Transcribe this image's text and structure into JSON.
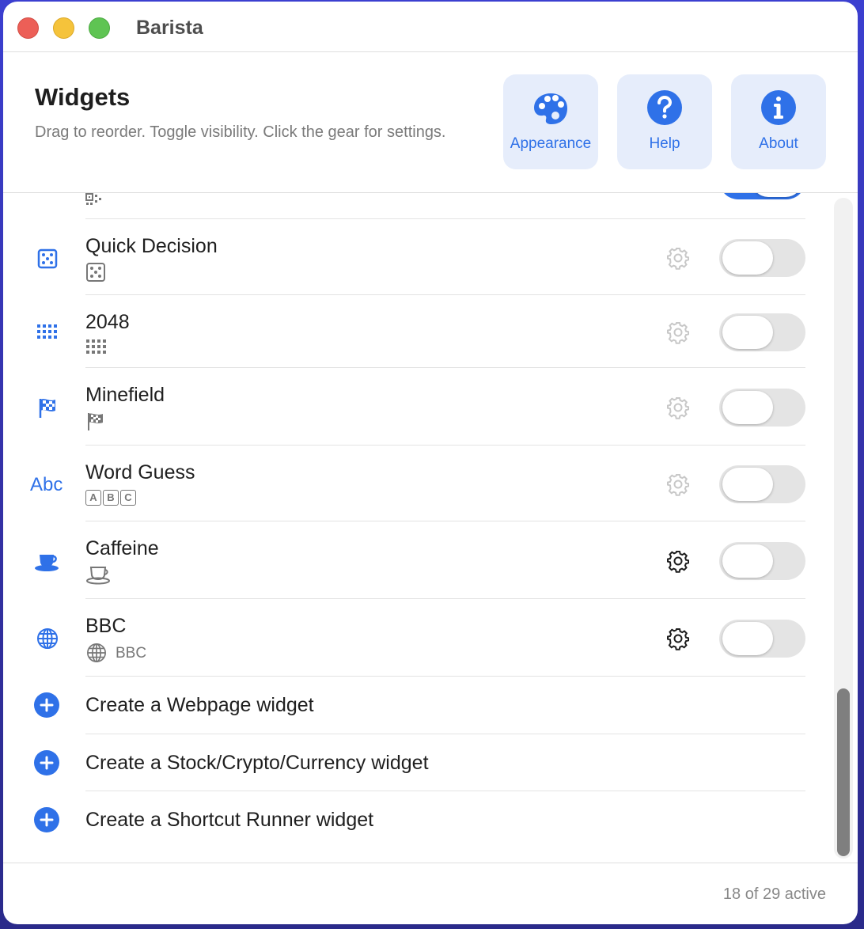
{
  "window": {
    "title": "Barista"
  },
  "header": {
    "title": "Widgets",
    "subtitle": "Drag to reorder. Toggle visibility. Click the gear for settings.",
    "buttons": [
      {
        "label": "Appearance",
        "icon": "palette-icon"
      },
      {
        "label": "Help",
        "icon": "question-circle-icon"
      },
      {
        "label": "About",
        "icon": "info-circle-icon"
      }
    ]
  },
  "widgets": [
    {
      "name": "",
      "icon": "qrcode-icon",
      "toggle": "on",
      "partial": true
    },
    {
      "name": "Quick Decision",
      "icon": "die-icon",
      "gear": "disabled",
      "toggle": "off"
    },
    {
      "name": "2048",
      "icon": "grid-icon",
      "gear": "disabled",
      "toggle": "off"
    },
    {
      "name": "Minefield",
      "icon": "checkered-flag-icon",
      "gear": "disabled",
      "toggle": "off"
    },
    {
      "name": "Word Guess",
      "icon_text": "Abc",
      "sub_letters": [
        "A",
        "B",
        "C"
      ],
      "gear": "disabled",
      "toggle": "off"
    },
    {
      "name": "Caffeine",
      "icon": "coffee-cup-icon",
      "gear": "enabled",
      "toggle": "off"
    },
    {
      "name": "BBC",
      "icon": "globe-icon",
      "sub_label": "BBC",
      "gear": "enabled",
      "toggle": "off"
    }
  ],
  "create_actions": [
    {
      "label": "Create a Webpage widget"
    },
    {
      "label": "Create a Stock/Crypto/Currency widget"
    },
    {
      "label": "Create a Shortcut Runner widget"
    }
  ],
  "footer": {
    "status": "18 of 29 active"
  },
  "colors": {
    "accent": "#2f71e8",
    "accent_bg": "#e6edfb",
    "toggle_on": "#2f71e8",
    "toggle_off": "#e4e4e4"
  }
}
